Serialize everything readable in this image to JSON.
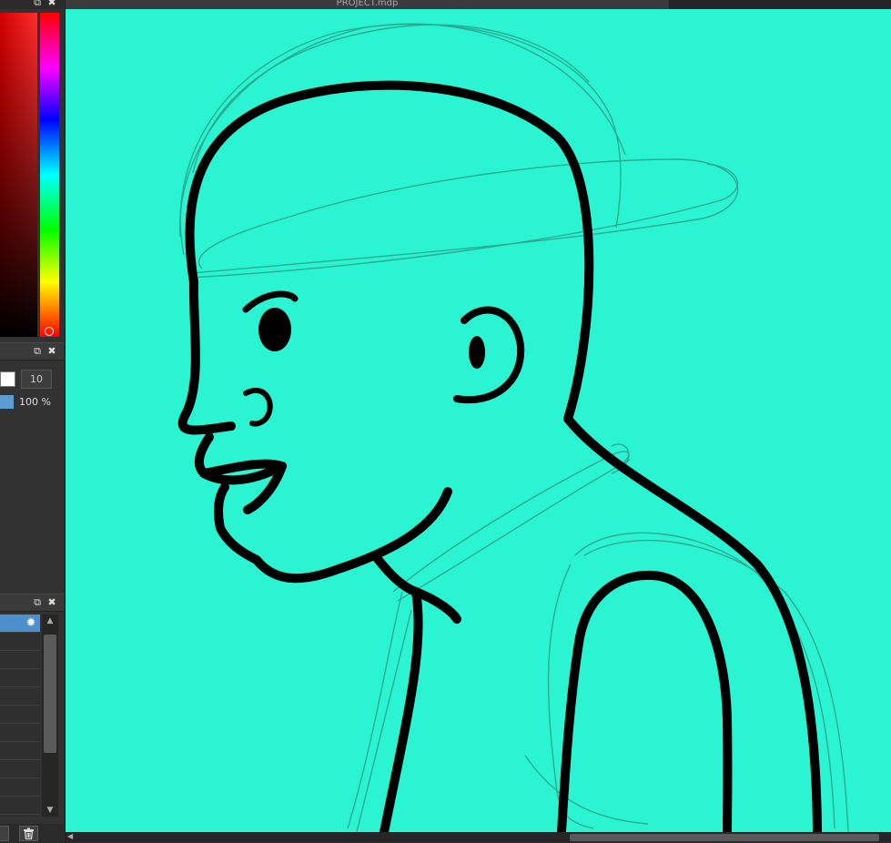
{
  "window": {
    "title": "PROJECT.mdp"
  },
  "brush": {
    "size_value": "10",
    "opacity_text": "100 %"
  },
  "icons": {
    "popout": "popout-icon",
    "close": "close-icon",
    "gear": "gear-icon",
    "trash": "trash-icon",
    "scroll_up": "arrow-up-icon",
    "scroll_down": "arrow-down-icon",
    "scroll_left": "arrow-left-icon"
  },
  "colors": {
    "canvas": "#2bf4d2",
    "ink": "#000000",
    "sketch": "#2aa58c",
    "selected_layer": "#4d8fcd",
    "brush_color": "#ffffff"
  },
  "glyphs": {
    "close": "✖",
    "popout": "⧉",
    "gear": "✹",
    "up": "▲",
    "down": "▼",
    "left": "◀",
    "trash": "🗑"
  }
}
